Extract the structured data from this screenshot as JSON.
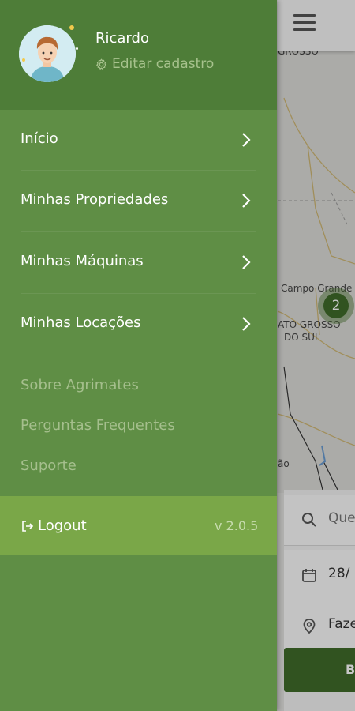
{
  "user": {
    "name": "Ricardo",
    "edit_label": "Editar cadastro"
  },
  "menu": {
    "items": [
      {
        "label": "Início"
      },
      {
        "label": "Minhas Propriedades"
      },
      {
        "label": "Minhas Máquinas"
      },
      {
        "label": "Minhas Locações"
      }
    ],
    "secondary": [
      {
        "label": "Sobre Agrimates"
      },
      {
        "label": "Perguntas Frequentes"
      },
      {
        "label": "Suporte"
      }
    ],
    "logout_label": "Logout",
    "version": "v 2.0.5"
  },
  "map": {
    "labels": [
      "GROSSO",
      "Campo Grande",
      "ATO GROSSO",
      "DO SUL",
      "ão"
    ],
    "cluster_count": "2"
  },
  "search": {
    "query_placeholder": "Que",
    "date_value": "28/",
    "location_value": "Faze",
    "button_label": "B"
  },
  "colors": {
    "drawer": "#5f8e45",
    "profile_header": "#4e7d38",
    "logout_bar": "#7aa748",
    "primary": "#3f6b2a"
  }
}
